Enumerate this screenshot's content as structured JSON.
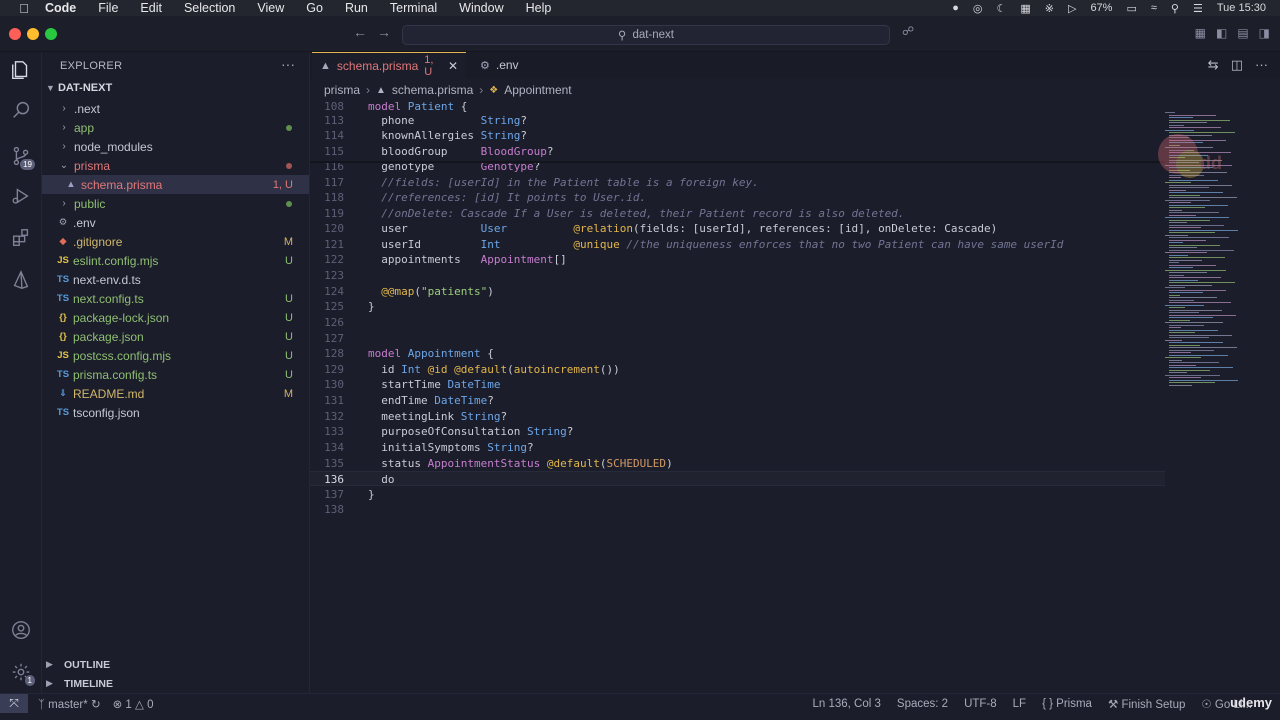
{
  "menubar": {
    "app": "Code",
    "items": [
      "File",
      "Edit",
      "Selection",
      "View",
      "Go",
      "Run",
      "Terminal",
      "Window",
      "Help"
    ],
    "battery": "67%",
    "clock": "Tue 15:30"
  },
  "titlebar": {
    "search": "dat-next"
  },
  "activity": {
    "source_control_badge": "19",
    "accounts_badge": "1"
  },
  "sidebar": {
    "header": "EXPLORER",
    "project": "DAT-NEXT",
    "items": [
      {
        "label": ".next",
        "kind": "folder",
        "status": ""
      },
      {
        "label": "app",
        "kind": "folder",
        "status": "dot-green"
      },
      {
        "label": "node_modules",
        "kind": "folder",
        "status": ""
      },
      {
        "label": "prisma",
        "kind": "folder-open",
        "status": "dot-red"
      },
      {
        "label": "schema.prisma",
        "kind": "prisma",
        "status": "1, U"
      },
      {
        "label": "public",
        "kind": "folder",
        "status": "dot-green"
      },
      {
        "label": ".env",
        "kind": "gear",
        "status": ""
      },
      {
        "label": ".gitignore",
        "kind": "git",
        "status": "M"
      },
      {
        "label": "eslint.config.mjs",
        "kind": "js",
        "status": "U"
      },
      {
        "label": "next-env.d.ts",
        "kind": "ts",
        "status": ""
      },
      {
        "label": "next.config.ts",
        "kind": "ts",
        "status": "U"
      },
      {
        "label": "package-lock.json",
        "kind": "json",
        "status": "U"
      },
      {
        "label": "package.json",
        "kind": "json",
        "status": "U"
      },
      {
        "label": "postcss.config.mjs",
        "kind": "js",
        "status": "U"
      },
      {
        "label": "prisma.config.ts",
        "kind": "ts",
        "status": "U"
      },
      {
        "label": "README.md",
        "kind": "md",
        "status": "M"
      },
      {
        "label": "tsconfig.json",
        "kind": "tsjson",
        "status": ""
      }
    ],
    "outline": "OUTLINE",
    "timeline": "TIMELINE"
  },
  "tabs": [
    {
      "label": "schema.prisma",
      "suffix": "1, U"
    },
    {
      "label": ".env",
      "suffix": ""
    }
  ],
  "breadcrumb": [
    "prisma",
    "schema.prisma",
    "Appointment"
  ],
  "code": {
    "sticky_line": "108",
    "current_line": "136"
  },
  "status": {
    "branch": "master*",
    "errors": "1",
    "warnings": "0",
    "position": "Ln 136, Col 3",
    "spaces": "Spaces: 2",
    "encoding": "UTF-8",
    "eol": "LF",
    "language": "Prisma",
    "setup": "Finish Setup",
    "golive": "Go Li..."
  },
  "watermark": "udemy"
}
